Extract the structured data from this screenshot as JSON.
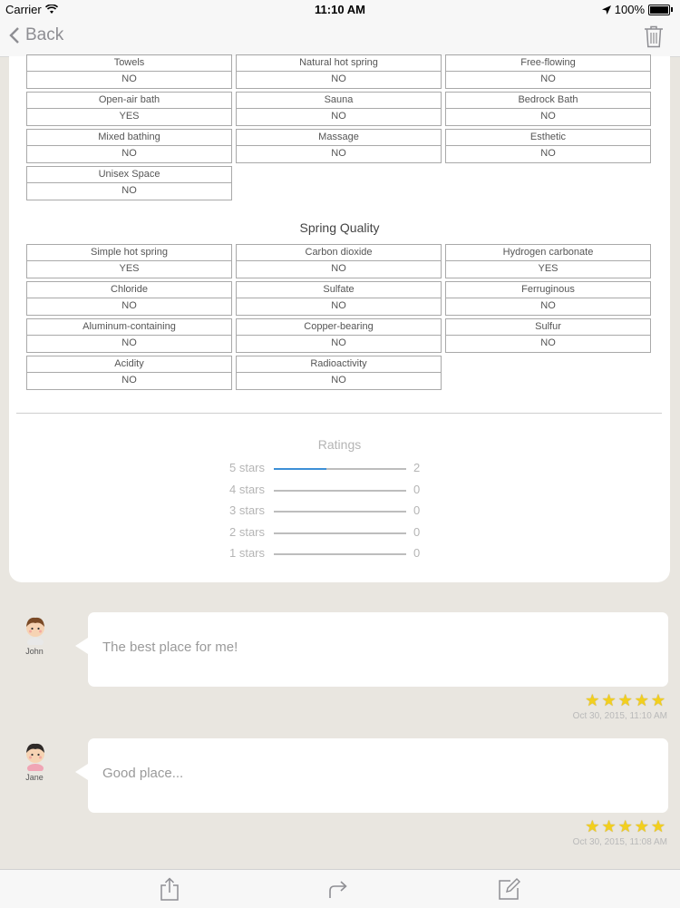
{
  "status_bar": {
    "carrier": "Carrier",
    "time": "11:10 AM",
    "battery": "100%"
  },
  "nav": {
    "back_label": "Back"
  },
  "facilities": [
    {
      "label": "Towels",
      "value": "NO"
    },
    {
      "label": "Natural hot spring",
      "value": "NO"
    },
    {
      "label": "Free-flowing",
      "value": "NO"
    },
    {
      "label": "Open-air bath",
      "value": "YES"
    },
    {
      "label": "Sauna",
      "value": "NO"
    },
    {
      "label": "Bedrock Bath",
      "value": "NO"
    },
    {
      "label": "Mixed bathing",
      "value": "NO"
    },
    {
      "label": "Massage",
      "value": "NO"
    },
    {
      "label": "Esthetic",
      "value": "NO"
    },
    {
      "label": "Unisex Space",
      "value": "NO"
    }
  ],
  "spring_quality": {
    "title": "Spring Quality",
    "items": [
      {
        "label": "Simple hot spring",
        "value": "YES"
      },
      {
        "label": "Carbon dioxide",
        "value": "NO"
      },
      {
        "label": "Hydrogen carbonate",
        "value": "YES"
      },
      {
        "label": "Chloride",
        "value": "NO"
      },
      {
        "label": "Sulfate",
        "value": "NO"
      },
      {
        "label": "Ferruginous",
        "value": "NO"
      },
      {
        "label": "Aluminum-containing",
        "value": "NO"
      },
      {
        "label": "Copper-bearing",
        "value": "NO"
      },
      {
        "label": "Sulfur",
        "value": "NO"
      },
      {
        "label": "Acidity",
        "value": "NO"
      },
      {
        "label": "Radioactivity",
        "value": "NO"
      }
    ]
  },
  "ratings": {
    "title": "Ratings",
    "rows": [
      {
        "label": "5 stars",
        "count": "2",
        "fraction": 0.4
      },
      {
        "label": "4 stars",
        "count": "0",
        "fraction": 0
      },
      {
        "label": "3 stars",
        "count": "0",
        "fraction": 0
      },
      {
        "label": "2 stars",
        "count": "0",
        "fraction": 0
      },
      {
        "label": "1 stars",
        "count": "0",
        "fraction": 0
      }
    ]
  },
  "comments": [
    {
      "name": "John",
      "text": "The best place for me!",
      "stars": 5,
      "date": "Oct 30, 2015, 11:10 AM"
    },
    {
      "name": "Jane",
      "text": "Good place...",
      "stars": 5,
      "date": "Oct 30, 2015, 11:08 AM"
    }
  ],
  "toolbar": {
    "icons": [
      "share-icon",
      "forward-icon",
      "compose-icon"
    ]
  },
  "colors": {
    "accent": "#3d8fd6",
    "star": "#f2cf1e",
    "background": "#e9e6e0"
  }
}
